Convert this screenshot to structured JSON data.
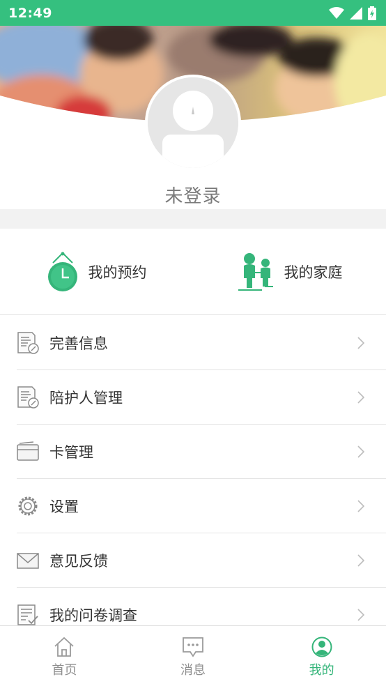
{
  "status_bar": {
    "time": "12:49",
    "icons": [
      "wifi-icon",
      "signal-icon",
      "battery-icon"
    ],
    "color": "#35c07f"
  },
  "profile": {
    "login_status": "未登录",
    "avatar_icon": "user-avatar-placeholder"
  },
  "quick_actions": [
    {
      "label": "我的预约",
      "icon": "clock-icon"
    },
    {
      "label": "我的家庭",
      "icon": "family-icon"
    }
  ],
  "menu": [
    {
      "label": "完善信息",
      "icon": "document-edit-icon"
    },
    {
      "label": "陪护人管理",
      "icon": "document-edit-icon"
    },
    {
      "label": "卡管理",
      "icon": "card-icon"
    },
    {
      "label": "设置",
      "icon": "gear-icon"
    },
    {
      "label": "意见反馈",
      "icon": "envelope-icon"
    },
    {
      "label": "我的问卷调查",
      "icon": "checklist-icon"
    }
  ],
  "tabs": [
    {
      "label": "首页",
      "icon": "home-icon",
      "active": false
    },
    {
      "label": "消息",
      "icon": "message-icon",
      "active": false
    },
    {
      "label": "我的",
      "icon": "user-icon",
      "active": true
    }
  ],
  "colors": {
    "accent": "#35b57a",
    "divider": "#e4e4e4",
    "inactive": "#8f8f8f"
  }
}
